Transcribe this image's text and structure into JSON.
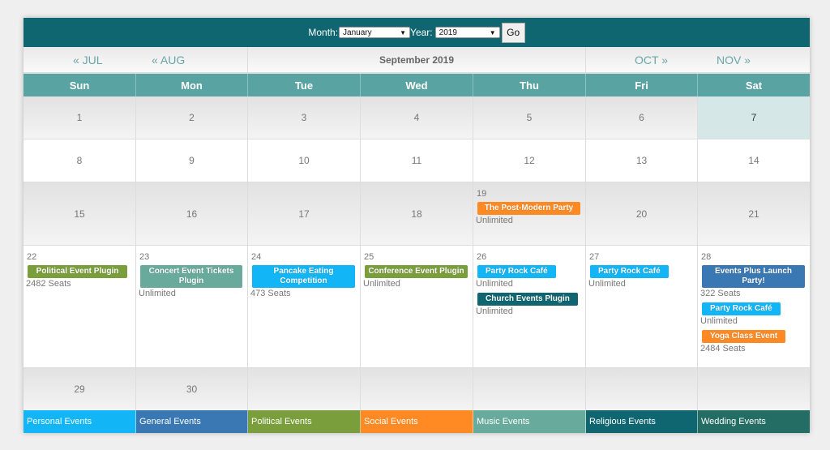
{
  "toolbar": {
    "month_label": "Month:",
    "month_value": "January",
    "year_label": "Year:",
    "year_value": "2019",
    "go_label": "Go"
  },
  "nav": {
    "prev2": "« JUL",
    "prev1": "« AUG",
    "current": "September 2019",
    "next1": "OCT »",
    "next2": "NOV »"
  },
  "weekdays": [
    "Sun",
    "Mon",
    "Tue",
    "Wed",
    "Thu",
    "Fri",
    "Sat"
  ],
  "weeks": {
    "w1": [
      "1",
      "2",
      "3",
      "4",
      "5",
      "6",
      "7"
    ],
    "w2": [
      "8",
      "9",
      "10",
      "11",
      "12",
      "13",
      "14"
    ],
    "w3": [
      "15",
      "16",
      "17",
      "18",
      "19",
      "20",
      "21"
    ],
    "w4": [
      "22",
      "23",
      "24",
      "25",
      "26",
      "27",
      "28"
    ],
    "w5": [
      "29",
      "30",
      "",
      "",
      "",
      "",
      ""
    ]
  },
  "today": "7",
  "events": {
    "d19": [
      {
        "title": "The Post-Modern Party",
        "info": "Unlimited",
        "category": "Social Events"
      }
    ],
    "d22": [
      {
        "title": "Political Event  Plugin",
        "info": "2482 Seats",
        "category": "Political Events"
      }
    ],
    "d23": [
      {
        "title": "Concert Event Tickets Plugin",
        "info": "Unlimited",
        "category": "Music Events"
      }
    ],
    "d24": [
      {
        "title": "Pancake Eating Competition",
        "info": "473 Seats",
        "category": "Personal Events"
      }
    ],
    "d25": [
      {
        "title": "Conference Event Plugin",
        "info": "Unlimited",
        "category": "Political Events"
      }
    ],
    "d26": [
      {
        "title": "Party Rock Café",
        "info": "Unlimited",
        "category": "Personal Events"
      },
      {
        "title": "Church Events Plugin",
        "info": "Unlimited",
        "category": "Religious Events"
      }
    ],
    "d27": [
      {
        "title": "Party Rock Café",
        "info": "Unlimited",
        "category": "Personal Events"
      }
    ],
    "d28": [
      {
        "title": "Events Plus Launch Party!",
        "info": "322 Seats",
        "category": "General Events"
      },
      {
        "title": "Party Rock Café",
        "info": "Unlimited",
        "category": "Personal Events"
      },
      {
        "title": "Yoga Class Event",
        "info": "2484 Seats",
        "category": "Social Events"
      }
    ]
  },
  "legend": [
    {
      "label": "Personal Events",
      "color": "#12b5f5"
    },
    {
      "label": "General Events",
      "color": "#3a78b3"
    },
    {
      "label": "Political Events",
      "color": "#7b9e3c"
    },
    {
      "label": "Social Events",
      "color": "#ff8a23"
    },
    {
      "label": "Music Events",
      "color": "#68aa9c"
    },
    {
      "label": "Religious Events",
      "color": "#0f6670"
    },
    {
      "label": "Wedding Events",
      "color": "#236d64"
    }
  ],
  "colors": {
    "header_bg": "#0f6670",
    "weekday_bg": "#5aa3a3",
    "today_bg": "#d5e8e7"
  }
}
